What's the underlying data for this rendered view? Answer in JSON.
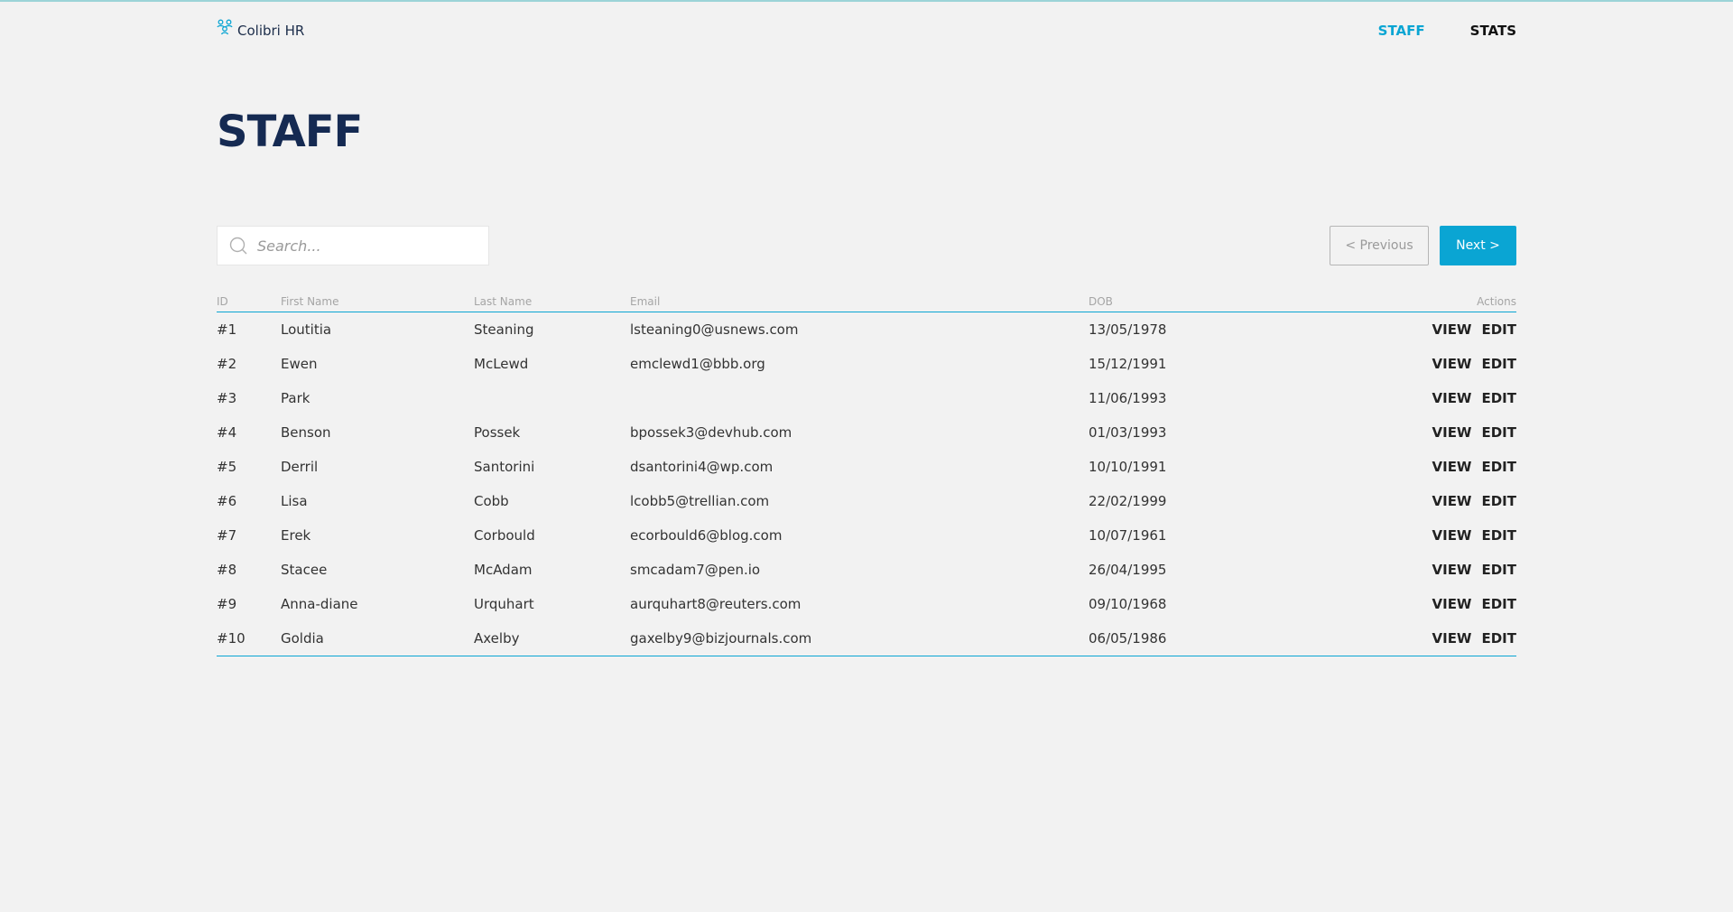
{
  "brand": {
    "name": "Colibri HR",
    "icon": "people-icon",
    "accent_color": "#0aa5d3"
  },
  "nav": {
    "staff_label": "STAFF",
    "stats_label": "STATS"
  },
  "page": {
    "title": "STAFF"
  },
  "search": {
    "placeholder": "Search...",
    "value": ""
  },
  "pagination": {
    "previous_label": "< Previous",
    "next_label": "Next >"
  },
  "table": {
    "headers": {
      "id": "ID",
      "first_name": "First Name",
      "last_name": "Last Name",
      "email": "Email",
      "dob": "DOB",
      "actions": "Actions"
    },
    "action_labels": {
      "view": "VIEW",
      "edit": "EDIT"
    },
    "rows": [
      {
        "id": "#1",
        "first_name": "Loutitia",
        "last_name": "Steaning",
        "email": "lsteaning0@usnews.com",
        "dob": "13/05/1978"
      },
      {
        "id": "#2",
        "first_name": "Ewen",
        "last_name": "McLewd",
        "email": "emclewd1@bbb.org",
        "dob": "15/12/1991"
      },
      {
        "id": "#3",
        "first_name": "Park",
        "last_name": "",
        "email": "",
        "dob": "11/06/1993"
      },
      {
        "id": "#4",
        "first_name": "Benson",
        "last_name": "Possek",
        "email": "bpossek3@devhub.com",
        "dob": "01/03/1993"
      },
      {
        "id": "#5",
        "first_name": "Derril",
        "last_name": "Santorini",
        "email": "dsantorini4@wp.com",
        "dob": "10/10/1991"
      },
      {
        "id": "#6",
        "first_name": "Lisa",
        "last_name": "Cobb",
        "email": "lcobb5@trellian.com",
        "dob": "22/02/1999"
      },
      {
        "id": "#7",
        "first_name": "Erek",
        "last_name": "Corbould",
        "email": "ecorbould6@blog.com",
        "dob": "10/07/1961"
      },
      {
        "id": "#8",
        "first_name": "Stacee",
        "last_name": "McAdam",
        "email": "smcadam7@pen.io",
        "dob": "26/04/1995"
      },
      {
        "id": "#9",
        "first_name": "Anna-diane",
        "last_name": "Urquhart",
        "email": "aurquhart8@reuters.com",
        "dob": "09/10/1968"
      },
      {
        "id": "#10",
        "first_name": "Goldia",
        "last_name": "Axelby",
        "email": "gaxelby9@bizjournals.com",
        "dob": "06/05/1986"
      }
    ]
  }
}
